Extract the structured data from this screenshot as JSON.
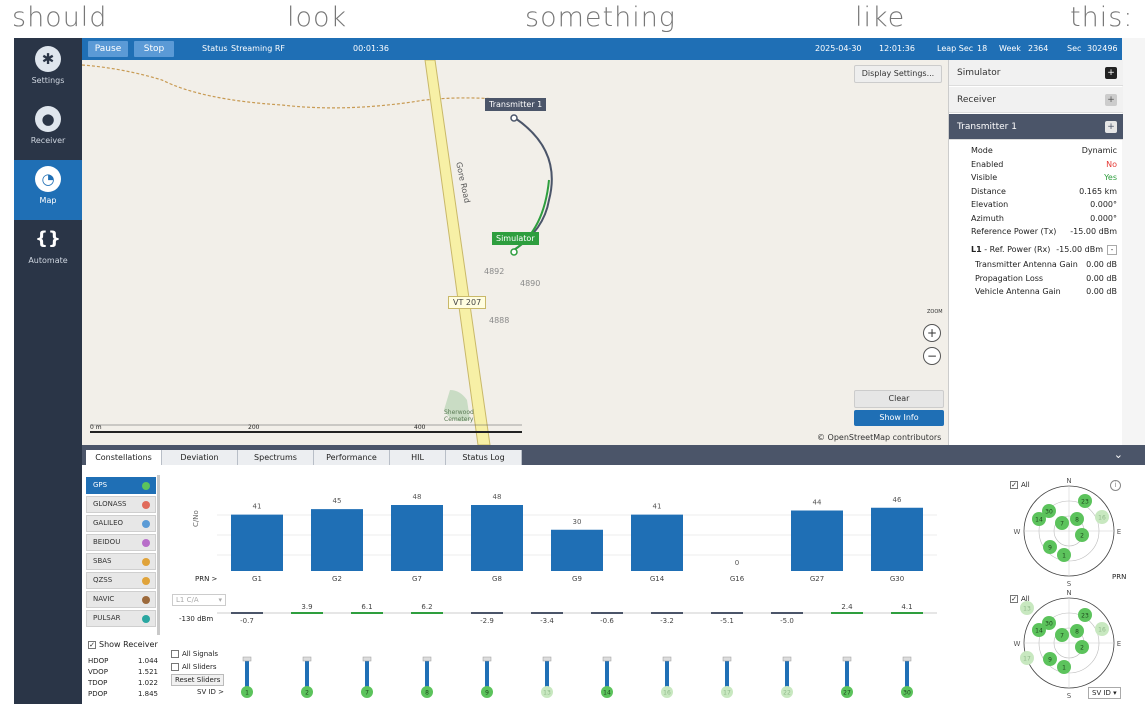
{
  "caption": {
    "w1": "should",
    "w2": "look",
    "w3": "something",
    "w4": "like",
    "w5": "this:"
  },
  "sidebar": {
    "items": [
      {
        "label": "Settings",
        "icon": "settings-icon"
      },
      {
        "label": "Receiver",
        "icon": "location-pin-icon"
      },
      {
        "label": "Map",
        "icon": "map-globe-icon"
      },
      {
        "label": "Automate",
        "icon": "braces-icon"
      }
    ]
  },
  "topbar": {
    "pause": "Pause",
    "stop": "Stop",
    "status_label": "Status",
    "status_value": "Streaming RF",
    "elapsed": "00:01:36",
    "date": "2025-04-30",
    "time": "12:01:36",
    "leap_label": "Leap Sec",
    "leap_value": "18",
    "week_label": "Week",
    "week_value": "2364",
    "sec_label": "Sec",
    "sec_value": "302496"
  },
  "map": {
    "display_settings": "Display Settings...",
    "transmitter_pin": "Transmitter 1",
    "simulator_pin": "Simulator",
    "road_name": "Gore Road",
    "road_shield": "VT 207",
    "addr1": "4892",
    "addr2": "4890",
    "addr3": "4888",
    "poi": "Sherwood Cemetery",
    "zoom_label": "ZOOM",
    "zoom_in": "+",
    "zoom_out": "−",
    "clear": "Clear",
    "show_info": "Show Info",
    "attribution": "© OpenStreetMap contributors",
    "scale_0": "0 m",
    "scale_1": "200",
    "scale_2": "400"
  },
  "panel": {
    "simulator": "Simulator",
    "receiver": "Receiver",
    "transmitter": "Transmitter 1",
    "rows": [
      {
        "k": "Mode",
        "v": "Dynamic"
      },
      {
        "k": "Enabled",
        "v": "No"
      },
      {
        "k": "Visible",
        "v": "Yes"
      },
      {
        "k": "Distance",
        "v": "0.165 km"
      },
      {
        "k": "Elevation",
        "v": "0.000°"
      },
      {
        "k": "Azimuth",
        "v": "0.000°"
      },
      {
        "k": "Reference Power (Tx)",
        "v": "-15.00 dBm"
      }
    ],
    "l1_band": "L1",
    "l1_label": "- Ref. Power (Rx)",
    "l1_value": "-15.00 dBm",
    "sub_rows": [
      {
        "k": "Transmitter Antenna Gain",
        "v": "0.00 dB"
      },
      {
        "k": "Propagation Loss",
        "v": "0.00 dB"
      },
      {
        "k": "Vehicle Antenna Gain",
        "v": "0.00 dB"
      }
    ],
    "colors": {
      "no": "#e53935",
      "yes": "#2e9e3e"
    }
  },
  "tabs": [
    "Constellations",
    "Deviation",
    "Spectrums",
    "Performance",
    "HIL",
    "Status Log"
  ],
  "constellations": [
    {
      "name": "GPS",
      "color": "#5cc35c"
    },
    {
      "name": "GLONASS",
      "color": "#e06b5b"
    },
    {
      "name": "GALILEO",
      "color": "#5b9bd6"
    },
    {
      "name": "BEIDOU",
      "color": "#b86ec9"
    },
    {
      "name": "SBAS",
      "color": "#e0a33a"
    },
    {
      "name": "QZSS",
      "color": "#e0a33a"
    },
    {
      "name": "NAVIC",
      "color": "#9c6a3c"
    },
    {
      "name": "PULSAR",
      "color": "#2aa7a1"
    }
  ],
  "show_receiver": "Show Receiver",
  "dop": [
    {
      "k": "HDOP",
      "v": "1.044"
    },
    {
      "k": "VDOP",
      "v": "1.521"
    },
    {
      "k": "TDOP",
      "v": "1.022"
    },
    {
      "k": "PDOP",
      "v": "1.845"
    }
  ],
  "controls": {
    "cno_label": "C/No",
    "prn_label": "PRN >",
    "signal_select": "L1 C/A",
    "power": "-130 dBm",
    "all_signals": "All Signals",
    "all_sliders": "All Sliders",
    "reset_sliders": "Reset Sliders",
    "svid_label": "SV ID >",
    "svid_select": "SV ID",
    "sky_all_1": "All",
    "sky_all_2": "All",
    "info": "i",
    "prn_corner": "PRN",
    "sky_n": "N",
    "sky_e": "E",
    "sky_s": "S",
    "sky_w": "W",
    "sky2_n": "N",
    "sky2_e": "E",
    "sky2_s": "S",
    "sky2_w": "W"
  },
  "chart_data": {
    "type": "bar",
    "categories": [
      "G1",
      "G2",
      "G7",
      "G8",
      "G9",
      "G14",
      "G16",
      "G27",
      "G30"
    ],
    "values": [
      41,
      45,
      48,
      48,
      30,
      41,
      0,
      44,
      46
    ],
    "deviation_values": [
      "-0.7",
      "3.9",
      "6.1",
      "6.2",
      "-2.9",
      "-3.4",
      "-0.6",
      "-3.2",
      "-5.1",
      "-5.0",
      "2.4",
      "4.1"
    ],
    "ylabel": "C/No",
    "ylim": [
      0,
      60
    ],
    "bar_color": "#1f6fb5"
  },
  "sv_ids": [
    "1",
    "2",
    "7",
    "8",
    "9",
    "13",
    "14",
    "16",
    "17",
    "22",
    "27",
    "30"
  ],
  "sv_active": [
    true,
    true,
    true,
    true,
    true,
    false,
    true,
    false,
    false,
    false,
    true,
    true
  ],
  "sky1_sats": [
    "14",
    "30",
    "23",
    "7",
    "8",
    "16",
    "2",
    "9",
    "1"
  ],
  "sky2_sats": [
    "13",
    "14",
    "30",
    "23",
    "7",
    "8",
    "16",
    "2",
    "17",
    "9",
    "1"
  ]
}
